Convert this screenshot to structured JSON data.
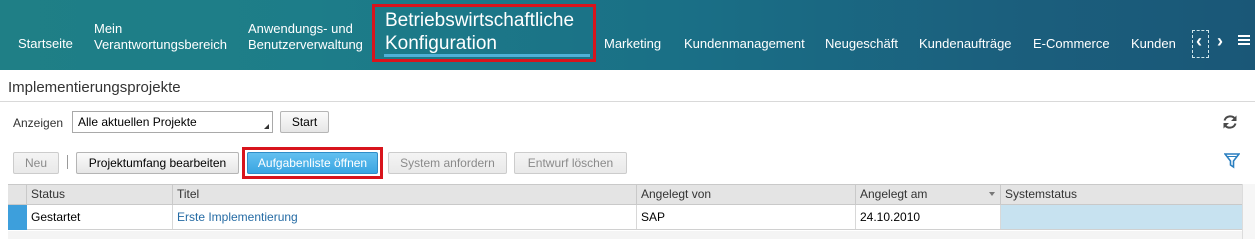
{
  "nav": {
    "items": [
      {
        "label": "Startseite"
      },
      {
        "label": "Mein",
        "label2": "Verantwortungsbereich"
      },
      {
        "label": "Anwendungs- und",
        "label2": "Benutzerverwaltung"
      },
      {
        "label": "Betriebswirtschaftliche",
        "label2": "Konfiguration"
      },
      {
        "label": "Marketing"
      },
      {
        "label": "Kundenmanagement"
      },
      {
        "label": "Neugeschäft"
      },
      {
        "label": "Kundenaufträge"
      },
      {
        "label": "E-Commerce"
      },
      {
        "label": "Kunden"
      }
    ],
    "prev_icon": "‹",
    "next_icon": "›"
  },
  "page": {
    "title": "Implementierungsprojekte"
  },
  "filter": {
    "label": "Anzeigen",
    "selected": "Alle aktuellen Projekte",
    "start_label": "Start"
  },
  "toolbar": {
    "new_label": "Neu",
    "edit_scope_label": "Projektumfang bearbeiten",
    "open_tasklist_label": "Aufgabenliste öffnen",
    "request_system_label": "System anfordern",
    "delete_draft_label": "Entwurf löschen"
  },
  "table": {
    "columns": [
      "Status",
      "Titel",
      "Angelegt von",
      "Angelegt am",
      "Systemstatus"
    ],
    "rows": [
      {
        "status": "Gestartet",
        "title": "Erste Implementierung",
        "created_by": "SAP",
        "created_on": "24.10.2010",
        "system_status": ""
      }
    ]
  },
  "colors": {
    "nav_bg": "#1d7d89",
    "highlight": "#d8141c",
    "primary_button": "#3aa5e1",
    "link": "#256ba4",
    "row_selector": "#3d9fdc"
  }
}
